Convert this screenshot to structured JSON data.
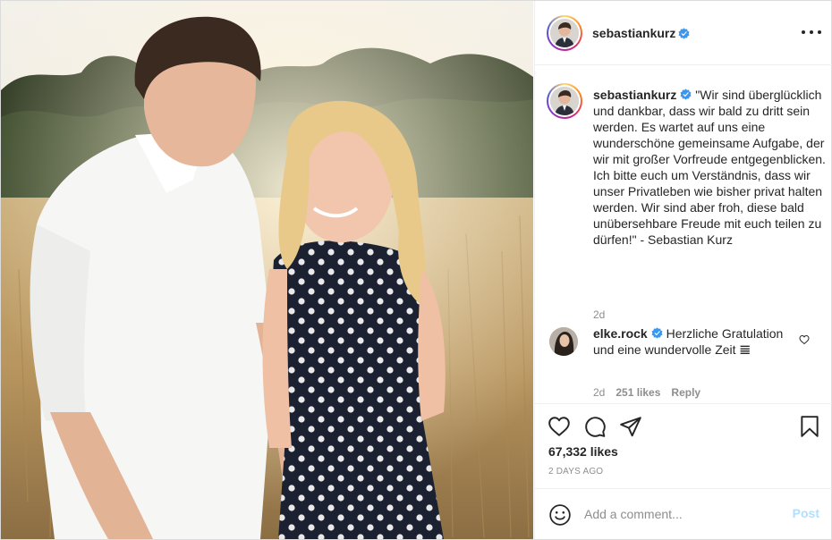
{
  "colors": {
    "accent": "#0095f6",
    "post_disabled": "#b2dffc",
    "muted": "#8e8e8e",
    "text": "#262626",
    "border": "#efefef"
  },
  "header": {
    "username": "sebastiankurz",
    "verified_icon": "verified-badge-icon",
    "more_icon": "more-options-icon"
  },
  "caption": {
    "username": "sebastiankurz",
    "text": "\"Wir sind überglücklich und dankbar, dass wir bald zu dritt sein werden. Es wartet auf uns eine wunderschöne gemeinsame Aufgabe, der wir mit großer Vorfreude entgegenblicken. Ich bitte euch um Verständnis, dass wir unser Privatleben wie bisher privat halten werden. Wir sind aber froh, diese bald unübersehbare Freude mit euch teilen zu dürfen!\" - Sebastian Kurz",
    "time": "2d"
  },
  "comment": {
    "username": "elke.rock",
    "text": "Herzliche Gratulation und eine wundervolle Zeit 𝌆",
    "time": "2d",
    "likes": "251 likes",
    "reply": "Reply"
  },
  "actions": {
    "icons": [
      "heart-icon",
      "comment-icon",
      "share-icon",
      "bookmark-icon"
    ],
    "likes": "67,332 likes",
    "time_ago": "2 DAYS AGO"
  },
  "add_comment": {
    "placeholder": "Add a comment...",
    "post_label": "Post",
    "emoji_icon": "emoji-icon"
  }
}
